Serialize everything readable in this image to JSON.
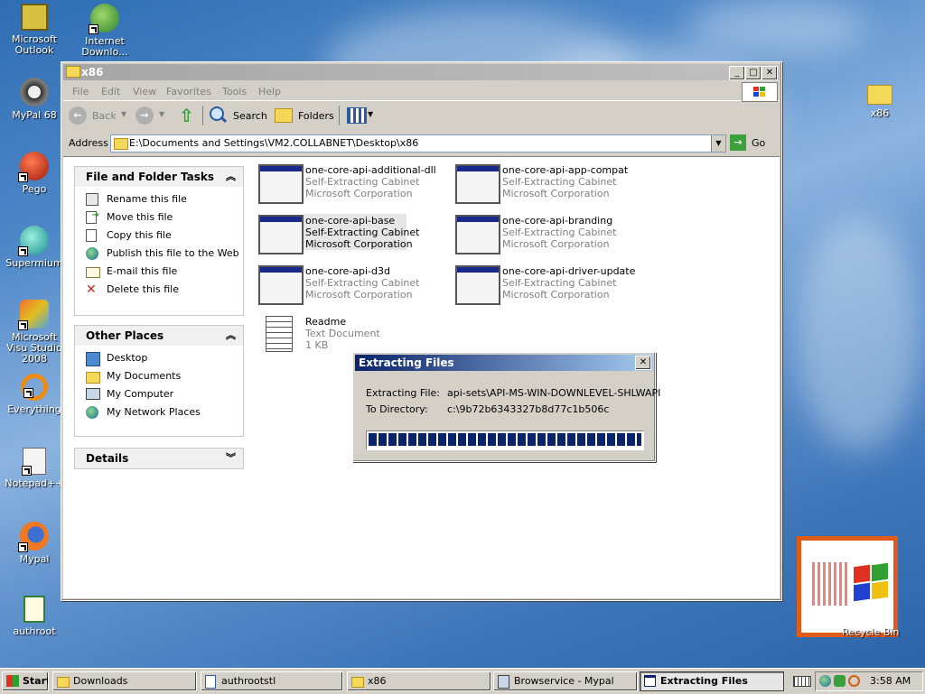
{
  "desktop": {
    "icons": [
      {
        "label": "Microsoft Outlook"
      },
      {
        "label": "Internet Downlo..."
      },
      {
        "label": "MyPal 68"
      },
      {
        "label": "Pego"
      },
      {
        "label": "Supermium"
      },
      {
        "label": "Microsoft Visu Studio 2008"
      },
      {
        "label": "Everything"
      },
      {
        "label": "Notepad++"
      },
      {
        "label": "Mypal"
      },
      {
        "label": "authroot"
      },
      {
        "label": "x86"
      },
      {
        "label": "Recycle Bin"
      }
    ]
  },
  "window": {
    "title": "x86",
    "menu": [
      "File",
      "Edit",
      "View",
      "Favorites",
      "Tools",
      "Help"
    ],
    "toolbar": {
      "back": "Back",
      "search": "Search",
      "folders": "Folders"
    },
    "address": {
      "label": "Address",
      "value": "E:\\Documents and Settings\\VM2.COLLABNET\\Desktop\\x86",
      "go": "Go"
    },
    "tasks_panel": {
      "title": "File and Folder Tasks",
      "items": [
        "Rename this file",
        "Move this file",
        "Copy this file",
        "Publish this file to the Web",
        "E-mail this file",
        "Delete this file"
      ]
    },
    "places_panel": {
      "title": "Other Places",
      "items": [
        "Desktop",
        "My Documents",
        "My Computer",
        "My Network Places"
      ]
    },
    "details_panel": {
      "title": "Details"
    },
    "files": [
      {
        "name": "one-core-api-additional-dll",
        "type": "Self-Extracting Cabinet",
        "info": "Microsoft Corporation"
      },
      {
        "name": "one-core-api-app-compat",
        "type": "Self-Extracting Cabinet",
        "info": "Microsoft Corporation"
      },
      {
        "name": "one-core-api-base",
        "type": "Self-Extracting Cabinet",
        "info": "Microsoft Corporation"
      },
      {
        "name": "one-core-api-branding",
        "type": "Self-Extracting Cabinet",
        "info": "Microsoft Corporation"
      },
      {
        "name": "one-core-api-d3d",
        "type": "Self-Extracting Cabinet",
        "info": "Microsoft Corporation"
      },
      {
        "name": "one-core-api-driver-update",
        "type": "Self-Extracting Cabinet",
        "info": "Microsoft Corporation"
      },
      {
        "name": "Readme",
        "type": "Text Document",
        "info": "1 KB"
      }
    ]
  },
  "dialog": {
    "title": "Extracting Files",
    "file_label": "Extracting File:",
    "file_value": "api-sets\\API-MS-WIN-DOWNLEVEL-SHLWAPI",
    "dir_label": "To Directory:",
    "dir_value": "c:\\9b72b6343327b8d77c1b506c",
    "progress_percent": 100
  },
  "taskbar": {
    "start": "Start",
    "tasks": [
      "Downloads",
      "authrootstl",
      "x86",
      "Browservice - Mypal",
      "Extracting Files"
    ],
    "clock": "3:58 AM"
  },
  "colors": {
    "titlebar_active": "#0a246a",
    "progress": "#0a246a",
    "desktop": "#3c74b8"
  }
}
